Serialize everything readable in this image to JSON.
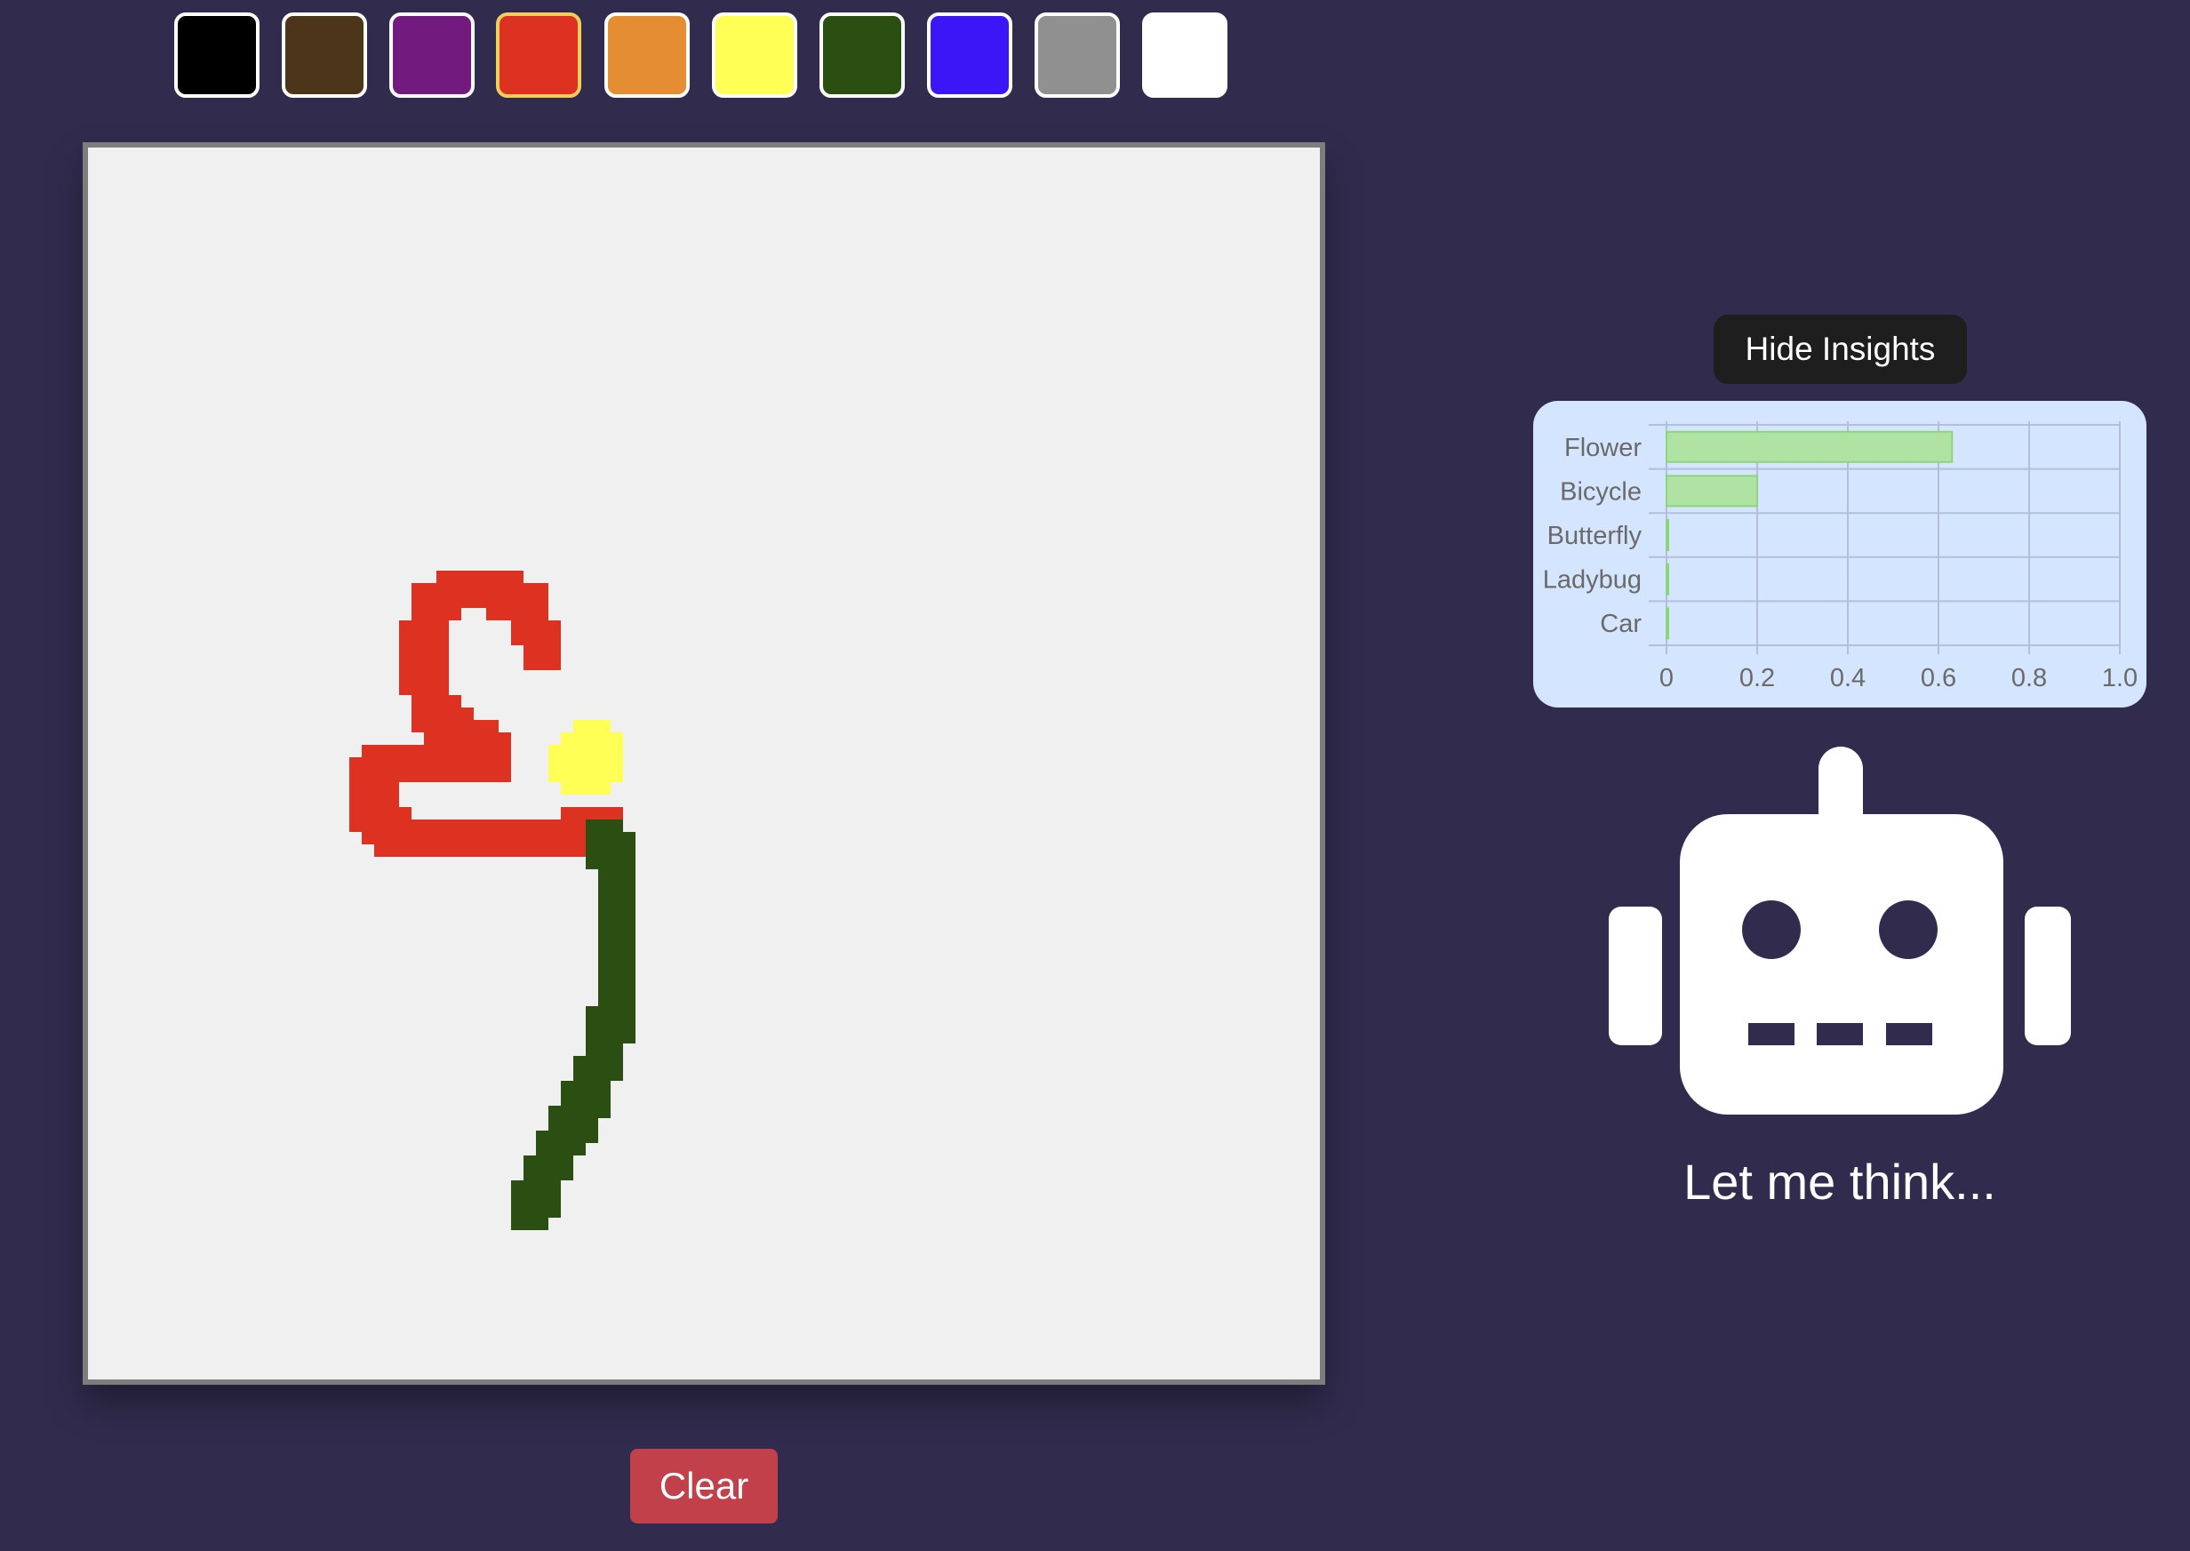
{
  "palette": {
    "colors": [
      {
        "name": "black",
        "hex": "#000000"
      },
      {
        "name": "brown",
        "hex": "#4d3519"
      },
      {
        "name": "purple",
        "hex": "#731a7f"
      },
      {
        "name": "red",
        "hex": "#dd3222"
      },
      {
        "name": "orange",
        "hex": "#e58d33"
      },
      {
        "name": "yellow",
        "hex": "#ffff55"
      },
      {
        "name": "dark-green",
        "hex": "#2b4f12"
      },
      {
        "name": "blue",
        "hex": "#3d16f7"
      },
      {
        "name": "gray",
        "hex": "#909090"
      },
      {
        "name": "white",
        "hex": "#ffffff"
      }
    ],
    "selected": "red"
  },
  "canvas": {
    "background": "#f0f0f0",
    "drawing_colors": {
      "red": "#dd3222",
      "yellow": "#ffff55",
      "green": "#2b4f12"
    }
  },
  "controls": {
    "clear_label": "Clear",
    "insights_label": "Hide Insights"
  },
  "chart_data": {
    "type": "bar",
    "orientation": "horizontal",
    "categories": [
      "Flower",
      "Bicycle",
      "Butterfly",
      "Ladybug",
      "Car"
    ],
    "values": [
      0.63,
      0.2,
      0.0,
      0.0,
      0.0
    ],
    "xlim": [
      0,
      1.0
    ],
    "xticks": [
      "0",
      "0.2",
      "0.4",
      "0.6",
      "0.8",
      "1.0"
    ],
    "bar_color": "#b0e3a3",
    "bar_border": "#8ed47c",
    "grid": true
  },
  "assistant": {
    "status": "Let me think..."
  }
}
